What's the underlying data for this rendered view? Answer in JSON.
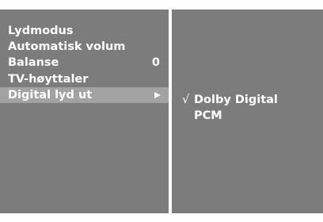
{
  "menu": {
    "items": [
      {
        "label": "Lydmodus",
        "value": ""
      },
      {
        "label": "Automatisk volum",
        "value": ""
      },
      {
        "label": "Balanse",
        "value": "0"
      },
      {
        "label": "TV-høyttaler",
        "value": ""
      },
      {
        "label": "Digital lyd ut",
        "value": "",
        "selected": true,
        "submenu": true
      }
    ],
    "submenu_icon": "right-triangle-icon"
  },
  "submenu": {
    "options": [
      {
        "label": "Dolby Digital",
        "checked": true,
        "check_mark": "√"
      },
      {
        "label": "PCM",
        "checked": false,
        "check_mark": ""
      }
    ],
    "check_icon": "check-mark-icon"
  },
  "colors": {
    "panel_background": "#7c7c7c",
    "selected_background": "#a2a2a2",
    "text": "#ffffff",
    "divider": "#ffffff"
  }
}
